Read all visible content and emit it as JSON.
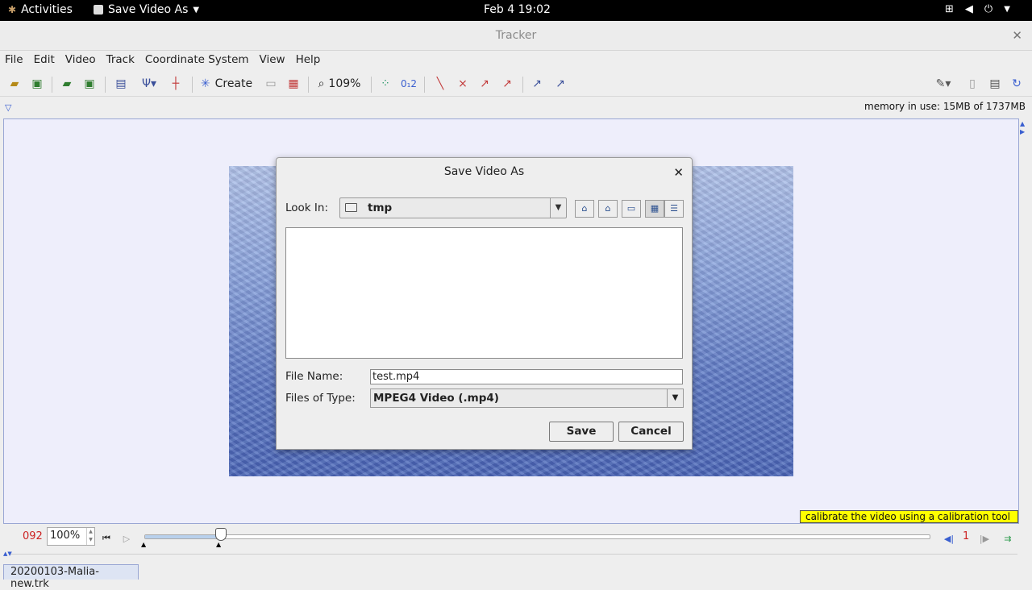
{
  "topbar": {
    "activities": "Activities",
    "app_menu": "Save Video As",
    "clock": "Feb 4  19:02"
  },
  "window": {
    "title": "Tracker"
  },
  "menu": [
    "File",
    "Edit",
    "Video",
    "Track",
    "Coordinate System",
    "View",
    "Help"
  ],
  "toolbar": {
    "create_label": "Create",
    "zoom_label": "109%"
  },
  "status": {
    "memory": "memory in use: 15MB of 1737MB",
    "hint": "calibrate the video using a calibration tool"
  },
  "player": {
    "frame_number": "092",
    "zoom_value": "100%",
    "step_count": "1",
    "slider_fraction": 0.097
  },
  "tab": {
    "label": "20200103-Malia-new.trk"
  },
  "dialog": {
    "title": "Save Video As",
    "look_in_label": "Look In:",
    "look_in_value": "tmp",
    "file_name_label": "File Name:",
    "file_name_value": "test.mp4",
    "files_of_type_label": "Files of Type:",
    "files_of_type_value": "MPEG4 Video (.mp4)",
    "save_label": "Save",
    "cancel_label": "Cancel"
  },
  "colors": {
    "frame_red": "#cc2222",
    "hint_bg": "#ffff00",
    "accent_blue": "#3a5fd0"
  }
}
